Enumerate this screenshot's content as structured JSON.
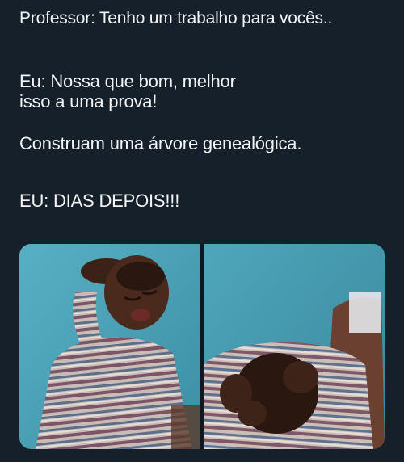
{
  "meme": {
    "lines": [
      "Professor: Tenho um trabalho para vocês..",
      "Eu: Nossa que bom, melhor",
      "isso a uma prova!",
      "Construam uma árvore genealógica.",
      "EU: DIAS DEPOIS!!!"
    ]
  },
  "colors": {
    "background": "#15202b",
    "text": "#f2f4f6",
    "wall": "#4aa0b4"
  },
  "images": {
    "left": "crying-boy-hand-on-head",
    "right": "boy-head-in-hands"
  }
}
